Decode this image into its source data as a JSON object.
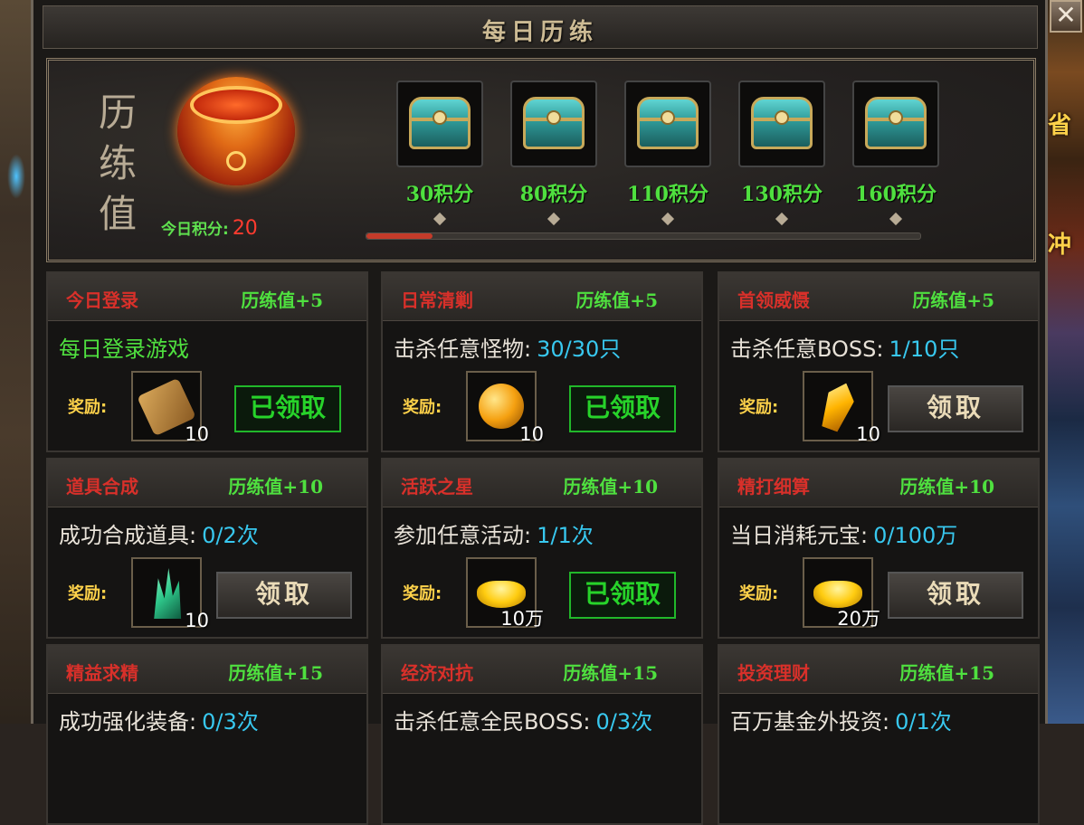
{
  "window": {
    "title": "每日历练",
    "close_symbol": "✕"
  },
  "side_tags": [
    "省",
    "冲"
  ],
  "header": {
    "calligraphy": [
      "历",
      "练",
      "值"
    ],
    "today_score_label": "今日积分:",
    "today_score_value": "20",
    "progress": {
      "current": 20,
      "max": 160
    },
    "chests": [
      {
        "label": "30积分"
      },
      {
        "label": "80积分"
      },
      {
        "label": "110积分"
      },
      {
        "label": "130积分"
      },
      {
        "label": "160积分"
      }
    ]
  },
  "reward_label": "奖励:",
  "tasks": [
    {
      "name": "今日登录",
      "points": "历练值+5",
      "desc": "每日登录游戏",
      "progress": "",
      "reward_icon": "scroll-icon",
      "reward_qty": "10",
      "button": "已领取",
      "claimed": true
    },
    {
      "name": "日常清剿",
      "points": "历练值+5",
      "desc": "击杀任意怪物:",
      "progress": "30/30只",
      "reward_icon": "orb-icon",
      "reward_qty": "10",
      "button": "已领取",
      "claimed": true
    },
    {
      "name": "首领威慑",
      "points": "历练值+5",
      "desc": "击杀任意BOSS:",
      "progress": "1/10只",
      "reward_icon": "gem-icon",
      "reward_qty": "10",
      "button": "领取",
      "claimed": false
    },
    {
      "name": "道具合成",
      "points": "历练值+10",
      "desc": "成功合成道具:",
      "progress": "0/2次",
      "reward_icon": "crystal-icon",
      "reward_qty": "10",
      "button": "领取",
      "claimed": false
    },
    {
      "name": "活跃之星",
      "points": "历练值+10",
      "desc": "参加任意活动:",
      "progress": "1/1次",
      "reward_icon": "ingot-icon",
      "reward_qty": "10万",
      "button": "已领取",
      "claimed": true
    },
    {
      "name": "精打细算",
      "points": "历练值+10",
      "desc": "当日消耗元宝:",
      "progress": "0/100万",
      "reward_icon": "ingot-icon",
      "reward_qty": "20万",
      "button": "领取",
      "claimed": false
    },
    {
      "name": "精益求精",
      "points": "历练值+15",
      "desc": "成功强化装备:",
      "progress": "0/3次"
    },
    {
      "name": "经济对抗",
      "points": "历练值+15",
      "desc": "击杀任意全民BOSS:",
      "progress": "0/3次"
    },
    {
      "name": "投资理财",
      "points": "历练值+15",
      "desc": "百万基金外投资:",
      "progress": "0/1次"
    }
  ]
}
